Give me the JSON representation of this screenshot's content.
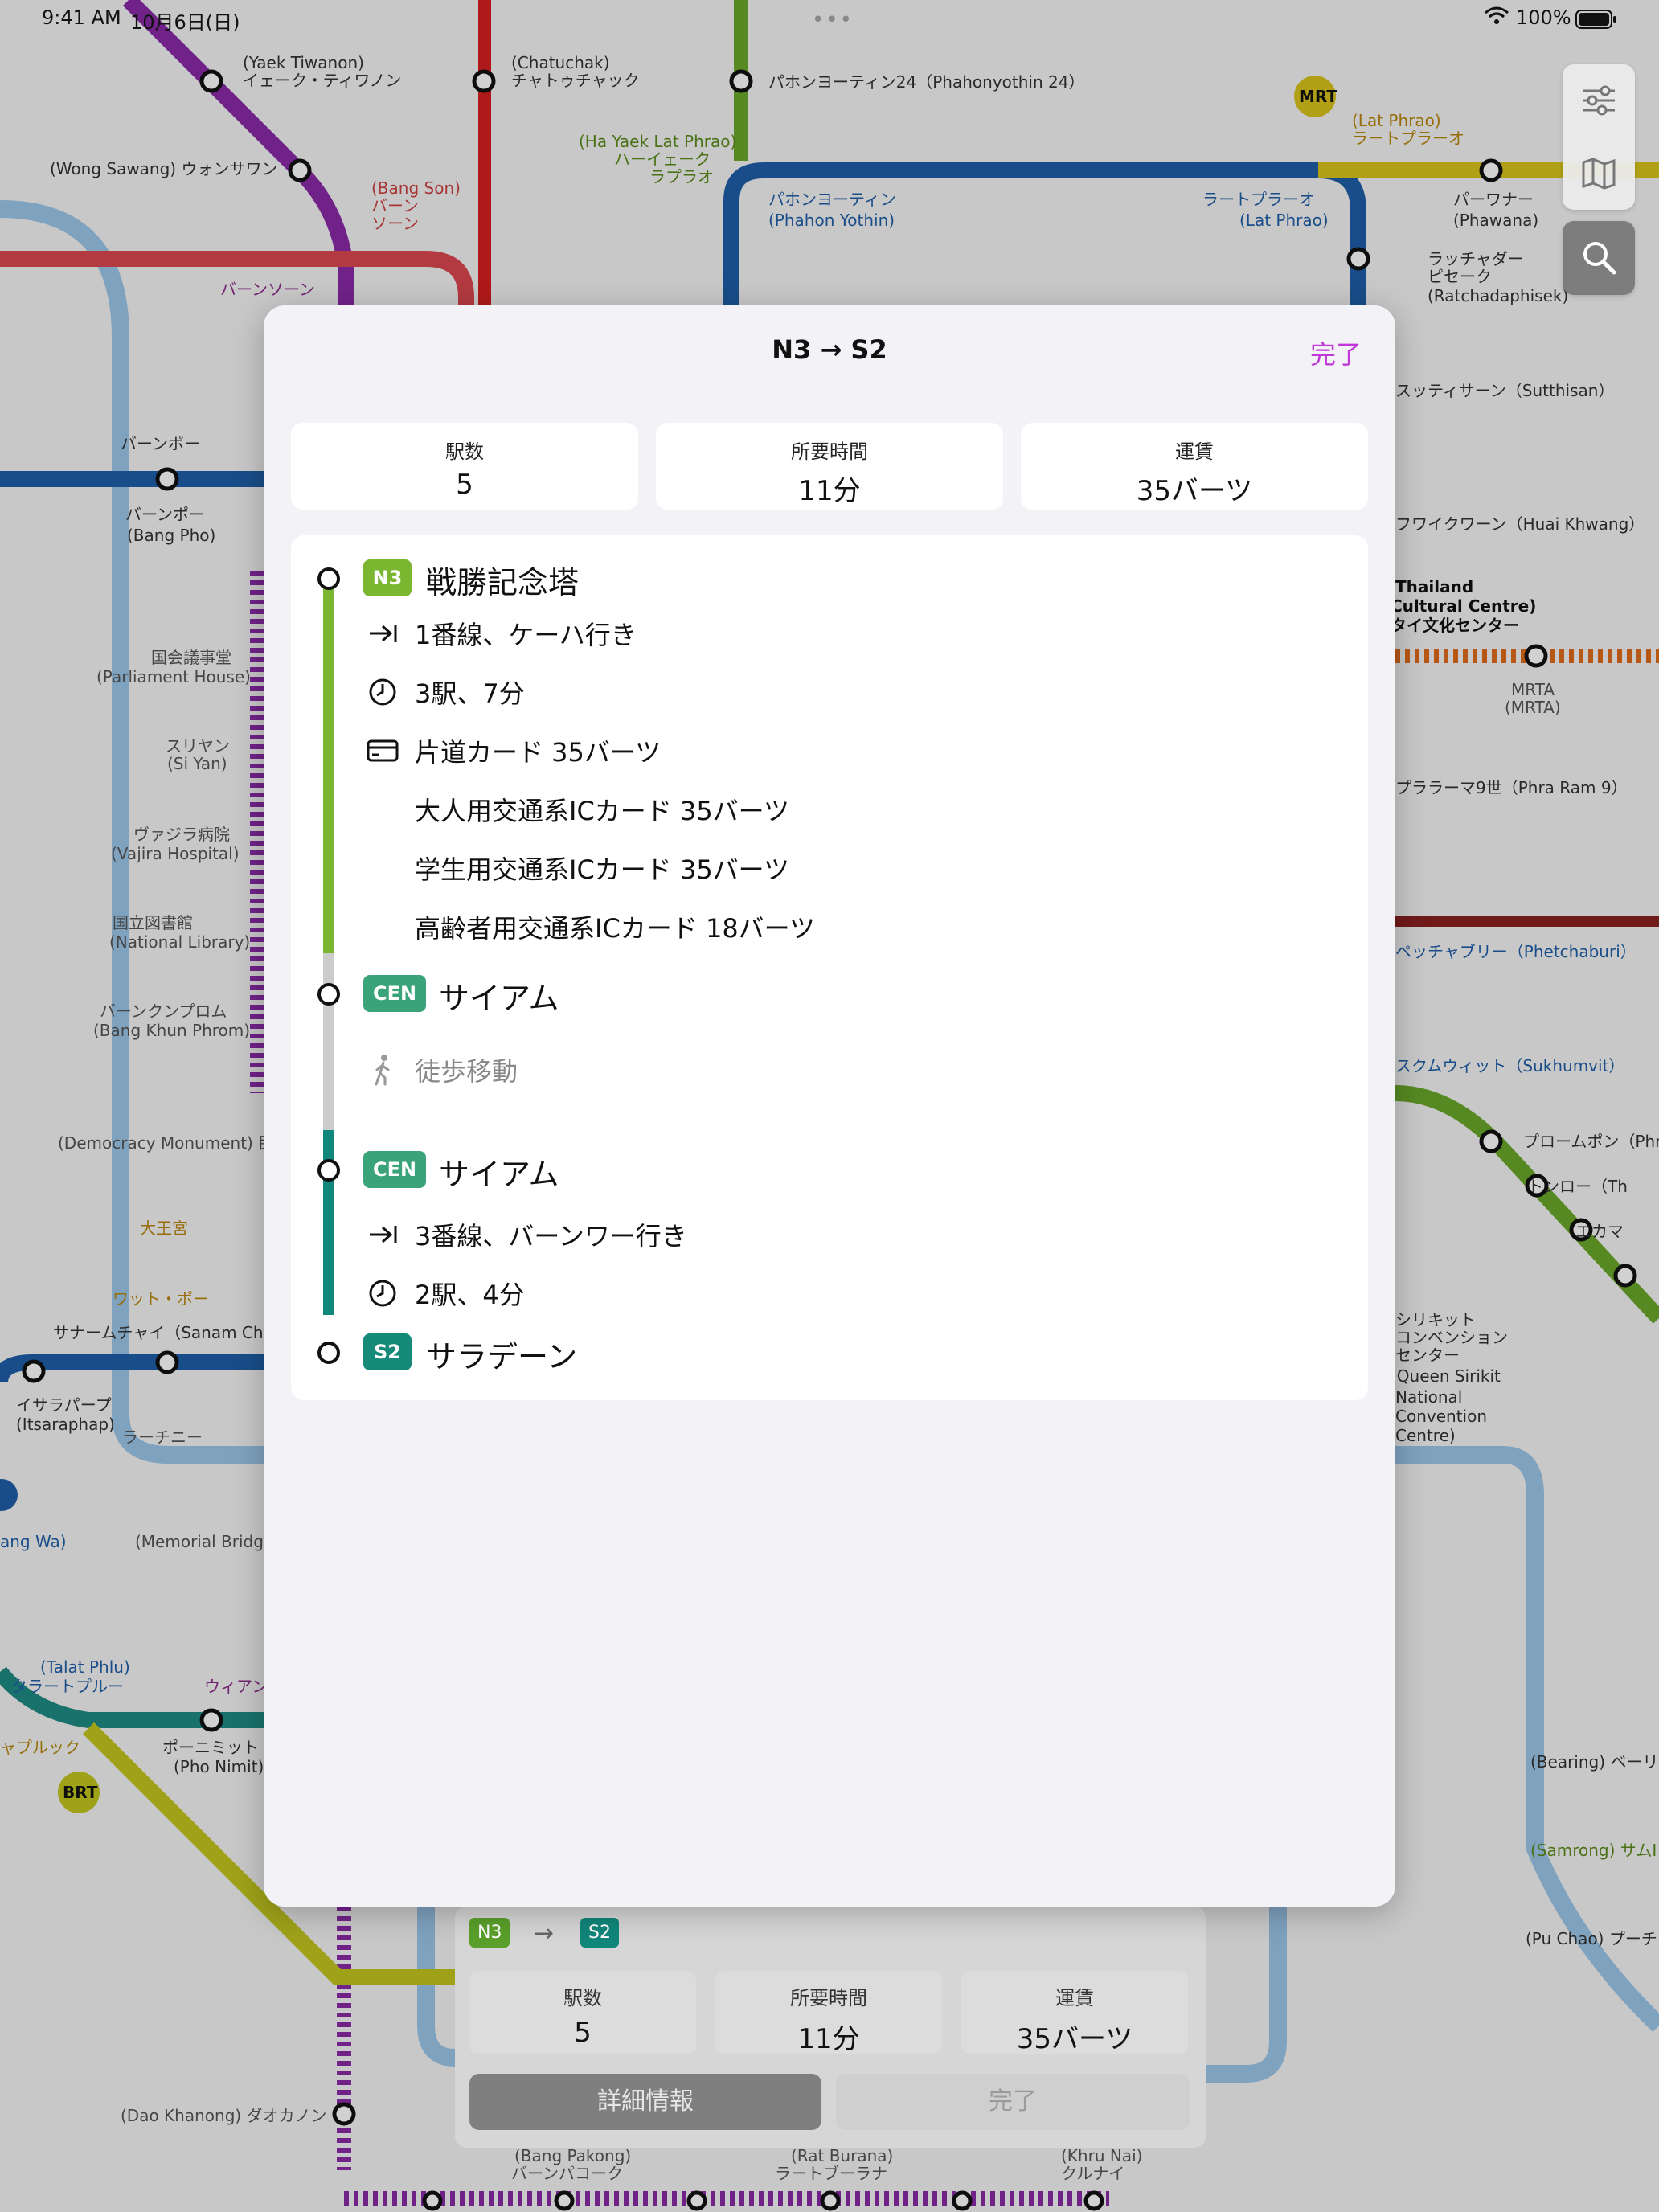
{
  "status_bar": {
    "time": "9:41 AM",
    "date": "10月6日(日)",
    "battery": "100%"
  },
  "map_labels": [
    {
      "text": "(Yaek Tiwanon)",
      "cls": ""
    },
    {
      "text": "イェーク・ティワノン",
      "cls": ""
    },
    {
      "text": "(Chatuchak)",
      "cls": ""
    },
    {
      "text": "チャトゥチャック",
      "cls": ""
    },
    {
      "text": "パホンヨーティン24（Phahonyothin 24）",
      "cls": ""
    },
    {
      "text": "(Wong Sawang) ウォンサワン",
      "cls": ""
    },
    {
      "text": "(Bang Son)",
      "cls": "red"
    },
    {
      "text": "バーン",
      "cls": "red"
    },
    {
      "text": "ソーン",
      "cls": "red"
    },
    {
      "text": "(Ha Yaek Lat Phrao)",
      "cls": "green"
    },
    {
      "text": "ハーイェーク",
      "cls": "green"
    },
    {
      "text": "ラプラオ",
      "cls": "green"
    },
    {
      "text": "パホンヨーティン",
      "cls": "blue"
    },
    {
      "text": "(Phahon Yothin)",
      "cls": "blue"
    },
    {
      "text": "ラートプラーオ",
      "cls": "blue"
    },
    {
      "text": "(Lat Phrao)",
      "cls": "blue"
    },
    {
      "text": "(Lat Phrao)",
      "cls": "gold"
    },
    {
      "text": "ラートプラーオ",
      "cls": "gold"
    },
    {
      "text": "パーワナー",
      "cls": ""
    },
    {
      "text": "(Phawana)",
      "cls": ""
    },
    {
      "text": "ラッチャダー",
      "cls": ""
    },
    {
      "text": "ピセーク",
      "cls": ""
    },
    {
      "text": "(Ratchadaphisek)",
      "cls": ""
    },
    {
      "text": "バーンソーン",
      "cls": "purple"
    },
    {
      "text": "バーンポー",
      "cls": ""
    },
    {
      "text": "バーンポー",
      "cls": ""
    },
    {
      "text": "(Bang Pho)",
      "cls": ""
    },
    {
      "text": "スッティサーン（Sutthisan）",
      "cls": ""
    },
    {
      "text": "フワイクワーン（Huai Khwang）",
      "cls": ""
    },
    {
      "text": "Thailand",
      "cls": "bold"
    },
    {
      "text": "Cultural Centre)",
      "cls": "bold"
    },
    {
      "text": "タイ文化センター",
      "cls": "bold"
    },
    {
      "text": "MRTA",
      "cls": "sub"
    },
    {
      "text": "(MRTA)",
      "cls": "sub"
    },
    {
      "text": "プララーマ9世（Phra Ram 9）",
      "cls": ""
    },
    {
      "text": "ペッチャブリー（Phetchaburi）",
      "cls": "blue"
    },
    {
      "text": "スクムウィット（Sukhumvit）",
      "cls": "blue"
    },
    {
      "text": "プロームポン（Phr",
      "cls": ""
    },
    {
      "text": "トンロー（Th",
      "cls": ""
    },
    {
      "text": "エカマ",
      "cls": ""
    },
    {
      "text": "シリキット",
      "cls": ""
    },
    {
      "text": "コンベンション",
      "cls": ""
    },
    {
      "text": "センター",
      "cls": ""
    },
    {
      "text": "(Queen Sirikit",
      "cls": ""
    },
    {
      "text": "National",
      "cls": ""
    },
    {
      "text": "Convention",
      "cls": ""
    },
    {
      "text": "Centre)",
      "cls": ""
    },
    {
      "text": "国会議事堂",
      "cls": "sub"
    },
    {
      "text": "(Parliament House)",
      "cls": "sub"
    },
    {
      "text": "スリヤン",
      "cls": "sub"
    },
    {
      "text": "(Si Yan)",
      "cls": "sub"
    },
    {
      "text": "ヴァジラ病院",
      "cls": "sub"
    },
    {
      "text": "(Vajira Hospital)",
      "cls": "sub"
    },
    {
      "text": "国立図書館",
      "cls": "sub"
    },
    {
      "text": "(National Library)",
      "cls": "sub"
    },
    {
      "text": "バーンクンプロム",
      "cls": "sub"
    },
    {
      "text": "(Bang Khun Phrom)",
      "cls": "sub"
    },
    {
      "text": "(Democracy Monument) 民主",
      "cls": "sub"
    },
    {
      "text": "大王宮",
      "cls": "gold"
    },
    {
      "text": "ワット・ポー",
      "cls": "gold"
    },
    {
      "text": "サナームチャイ（Sanam Cha",
      "cls": ""
    },
    {
      "text": "イサラパープ",
      "cls": ""
    },
    {
      "text": "(Itsaraphap)",
      "cls": ""
    },
    {
      "text": "ラーチニー",
      "cls": "sub"
    },
    {
      "text": "(Memorial Bridge)",
      "cls": "sub"
    },
    {
      "text": "ang Wa)",
      "cls": "blue"
    },
    {
      "text": "(Talat Phlu)",
      "cls": "blue"
    },
    {
      "text": "タラートプルー",
      "cls": "blue"
    },
    {
      "text": "ウィアン",
      "cls": "purple"
    },
    {
      "text": "ャプルック",
      "cls": "gold"
    },
    {
      "text": "ポーニミット",
      "cls": ""
    },
    {
      "text": "(Pho Nimit)",
      "cls": ""
    },
    {
      "text": "(Bearing) ベーリ",
      "cls": ""
    },
    {
      "text": "(Samrong) サムI",
      "cls": "green"
    },
    {
      "text": "(Pu Chao) プーチ",
      "cls": ""
    },
    {
      "text": "(Dao Khanong) ダオカノン",
      "cls": "sub"
    },
    {
      "text": "(Bang Pakong)",
      "cls": "sub"
    },
    {
      "text": "バーンパコーク",
      "cls": "sub"
    },
    {
      "text": "(Rat Burana)",
      "cls": "sub"
    },
    {
      "text": "ラートブーラナ",
      "cls": "sub"
    },
    {
      "text": "(Khru Nai)",
      "cls": "sub"
    },
    {
      "text": "クルナイ",
      "cls": "sub"
    },
    {
      "text": "MRT",
      "cls": "bold"
    },
    {
      "text": "BRT",
      "cls": "bold"
    }
  ],
  "sheet": {
    "title": "N3 → S2",
    "done_label": "完了",
    "stats": [
      {
        "label": "駅数",
        "value": "5"
      },
      {
        "label": "所要時間",
        "value": "11分"
      },
      {
        "label": "運賃",
        "value": "35バーツ"
      }
    ],
    "route": {
      "stations": [
        {
          "code": "N3",
          "name": "戦勝記念塔",
          "color": "#7ab62f"
        },
        {
          "code": "CEN",
          "name": "サイアム",
          "color": "#3aa37a"
        },
        {
          "code": "CEN",
          "name": "サイアム",
          "color": "#3aa37a"
        },
        {
          "code": "S2",
          "name": "サラデーン",
          "color": "#158a78"
        }
      ],
      "leg1": {
        "direction": "1番線、ケーハ行き",
        "stops_time": "3駅、7分",
        "fare_card": "片道カード 35バーツ",
        "fare_adult": "大人用交通系ICカード 35バーツ",
        "fare_student": "学生用交通系ICカード 35バーツ",
        "fare_senior": "高齢者用交通系ICカード 18バーツ"
      },
      "walk": "徒歩移動",
      "leg2": {
        "direction": "3番線、バーンワー行き",
        "stops_time": "2駅、4分"
      },
      "colors": {
        "leg1": "#7ab62f",
        "walk": "#cccccc",
        "leg2": "#11867a"
      }
    }
  },
  "mini_card": {
    "from_code": "N3",
    "to_code": "S2",
    "stats": [
      {
        "label": "駅数",
        "value": "5"
      },
      {
        "label": "所要時間",
        "value": "11分"
      },
      {
        "label": "運賃",
        "value": "35バーツ"
      }
    ],
    "details_button": "詳細情報",
    "done_button": "完了"
  },
  "icons": {
    "settings": "sliders-icon",
    "map": "map-icon",
    "search": "search-icon",
    "direction": "arrow-right-to-bar-icon",
    "time": "clock-icon",
    "fare": "card-icon",
    "walk": "walking-icon"
  }
}
